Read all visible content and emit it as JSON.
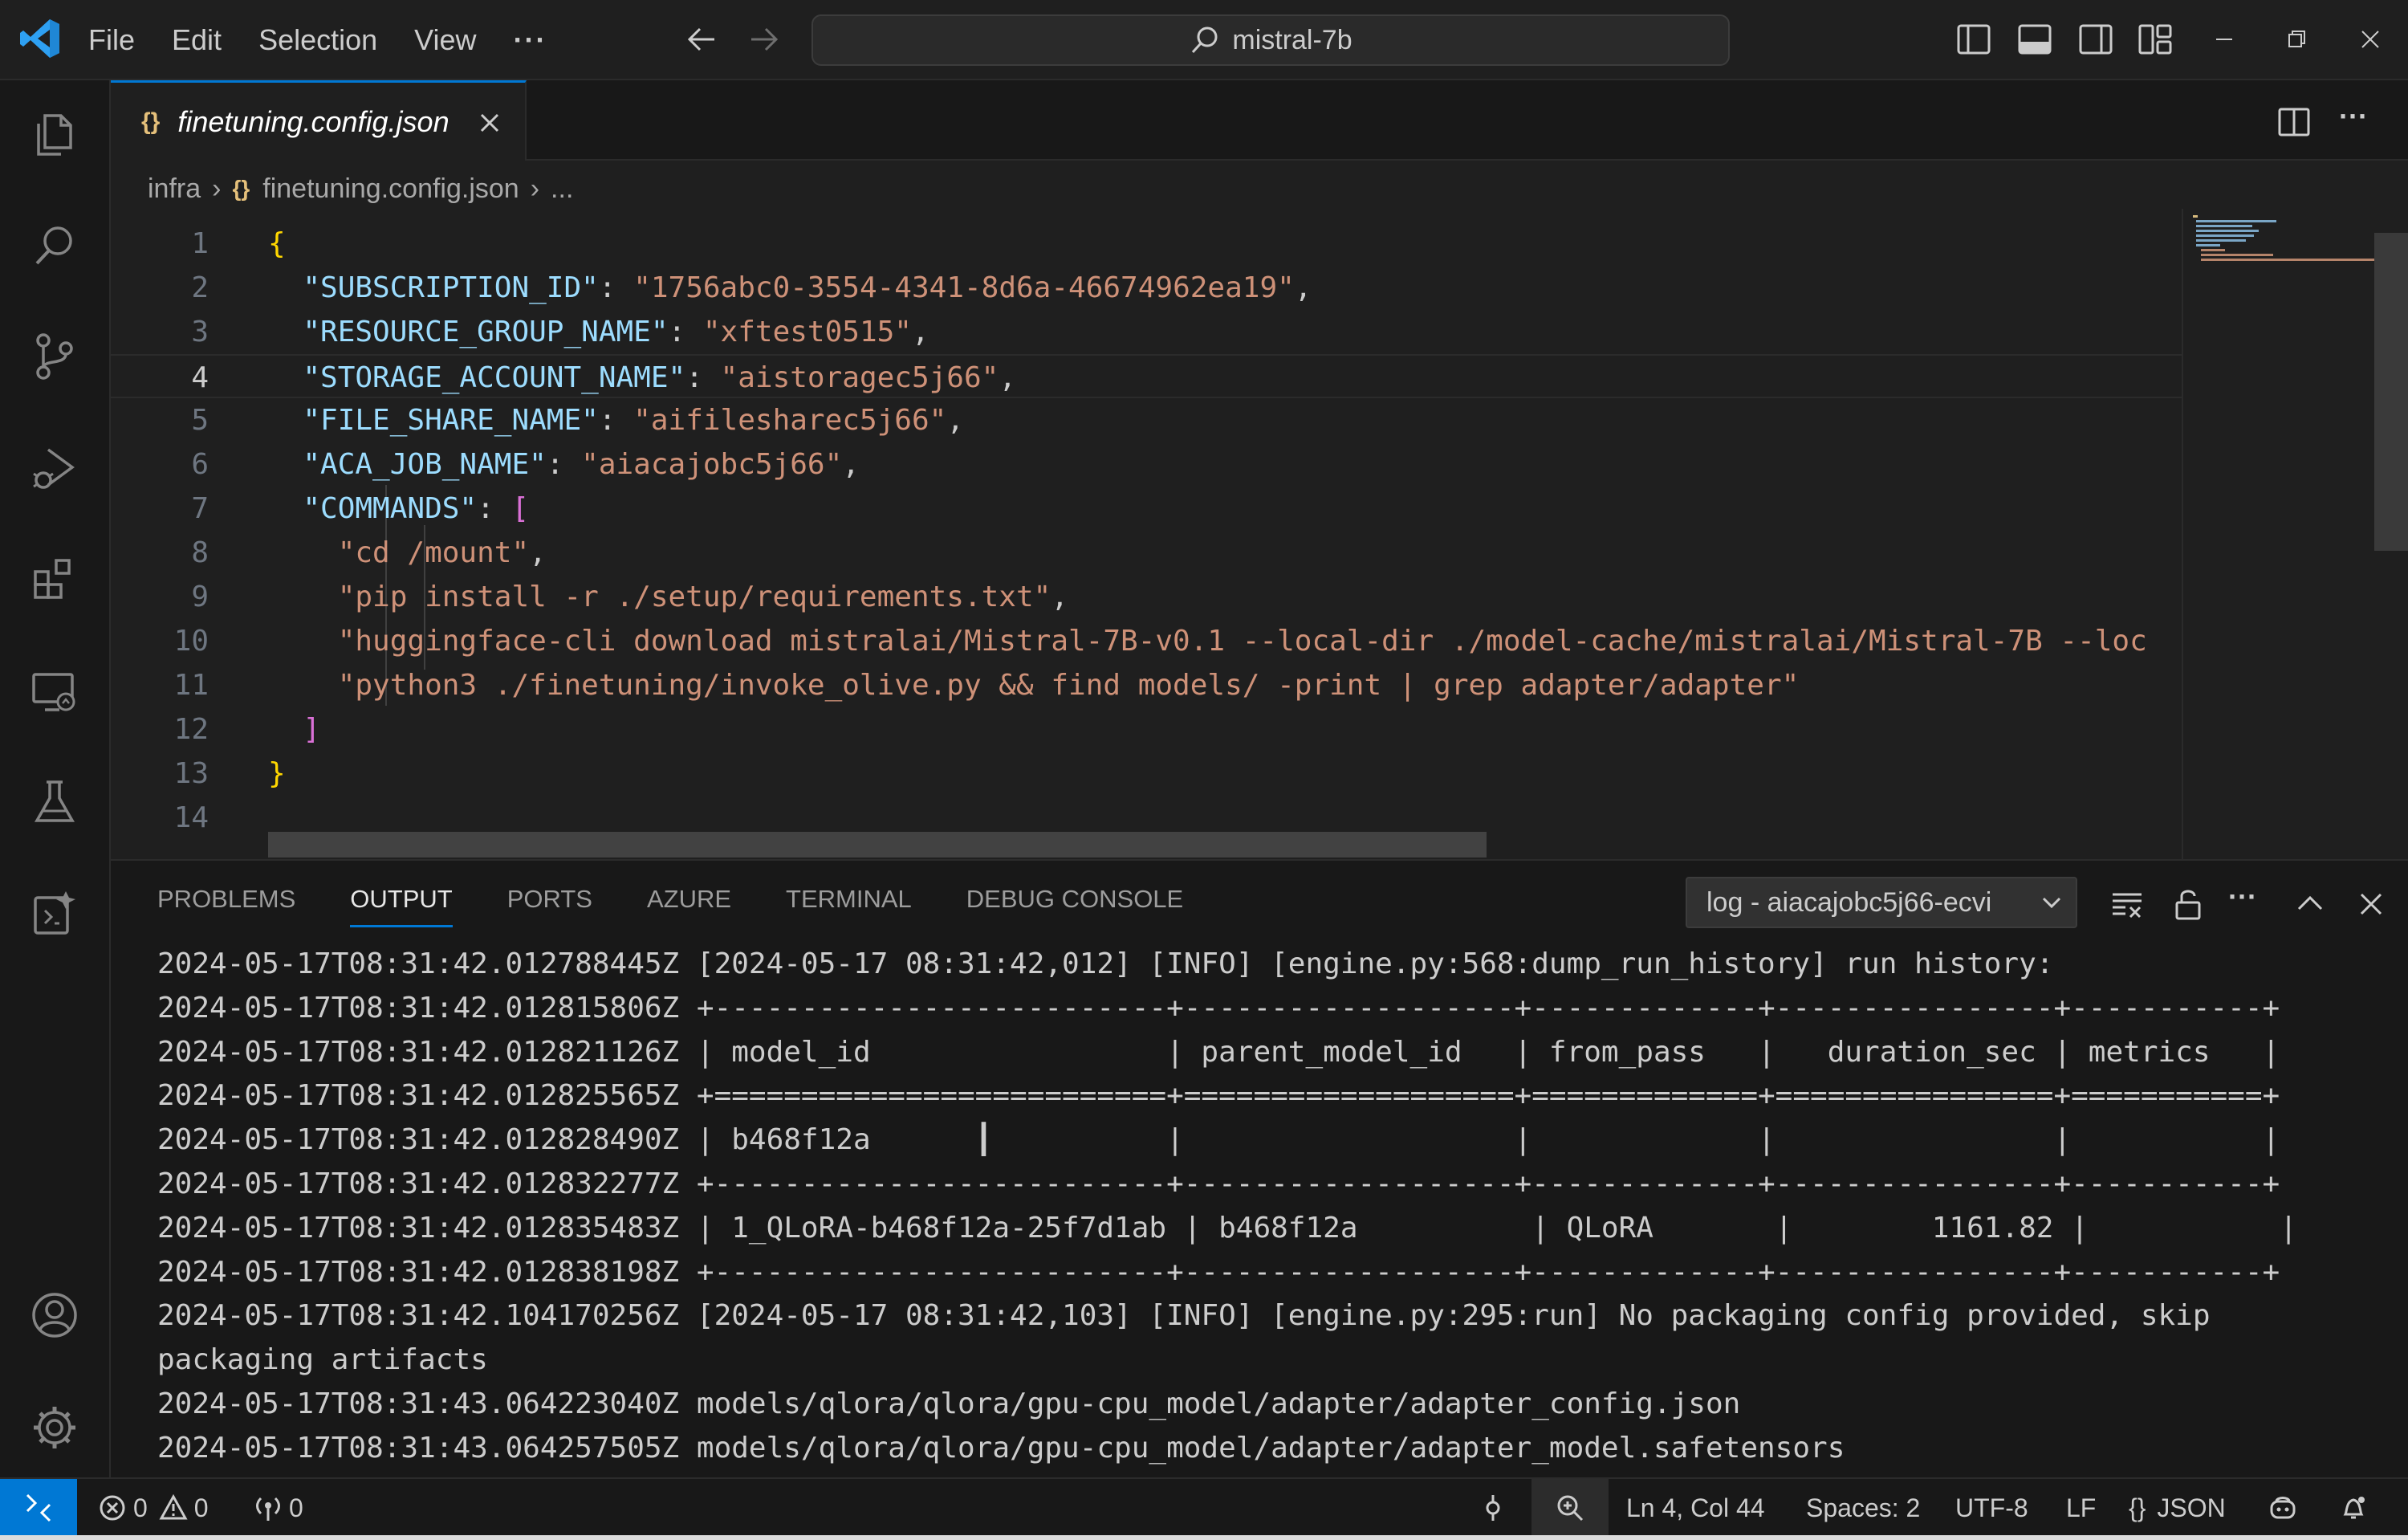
{
  "menu": [
    "File",
    "Edit",
    "Selection",
    "View"
  ],
  "search": {
    "text": "mistral-7b"
  },
  "tab": {
    "icon_text": "{}",
    "label": "finetuning.config.json"
  },
  "breadcrumb": {
    "folder": "infra",
    "icon_text": "{}",
    "file": "finetuning.config.json",
    "more": "..."
  },
  "editor": {
    "line_numbers": [
      "1",
      "2",
      "3",
      "4",
      "5",
      "6",
      "7",
      "8",
      "9",
      "10",
      "11",
      "12",
      "13",
      "14"
    ],
    "active_line": 4,
    "lines": [
      [
        {
          "t": "{",
          "c": "br1"
        }
      ],
      [
        {
          "t": "  "
        },
        {
          "t": "\"SUBSCRIPTION_ID\"",
          "c": "k"
        },
        {
          "t": ": "
        },
        {
          "t": "\"1756abc0-3554-4341-8d6a-46674962ea19\"",
          "c": "s"
        },
        {
          "t": ","
        }
      ],
      [
        {
          "t": "  "
        },
        {
          "t": "\"RESOURCE_GROUP_NAME\"",
          "c": "k"
        },
        {
          "t": ": "
        },
        {
          "t": "\"xftest0515\"",
          "c": "s"
        },
        {
          "t": ","
        }
      ],
      [
        {
          "t": "  "
        },
        {
          "t": "\"STORAGE_ACCOUNT_NAME\"",
          "c": "k"
        },
        {
          "t": ": "
        },
        {
          "t": "\"aistoragec5j66\"",
          "c": "s"
        },
        {
          "t": ","
        }
      ],
      [
        {
          "t": "  "
        },
        {
          "t": "\"FILE_SHARE_NAME\"",
          "c": "k"
        },
        {
          "t": ": "
        },
        {
          "t": "\"aifilesharec5j66\"",
          "c": "s"
        },
        {
          "t": ","
        }
      ],
      [
        {
          "t": "  "
        },
        {
          "t": "\"ACA_JOB_NAME\"",
          "c": "k"
        },
        {
          "t": ": "
        },
        {
          "t": "\"aiacajobc5j66\"",
          "c": "s"
        },
        {
          "t": ","
        }
      ],
      [
        {
          "t": "  "
        },
        {
          "t": "\"COMMANDS\"",
          "c": "k"
        },
        {
          "t": ": "
        },
        {
          "t": "[",
          "c": "br2"
        }
      ],
      [
        {
          "t": "    "
        },
        {
          "t": "\"cd /mount\"",
          "c": "s"
        },
        {
          "t": ","
        }
      ],
      [
        {
          "t": "    "
        },
        {
          "t": "\"pip install -r ./setup/requirements.txt\"",
          "c": "s"
        },
        {
          "t": ","
        }
      ],
      [
        {
          "t": "    "
        },
        {
          "t": "\"huggingface-cli download mistralai/Mistral-7B-v0.1 --local-dir ./model-cache/mistralai/Mistral-7B --loc",
          "c": "s"
        }
      ],
      [
        {
          "t": "    "
        },
        {
          "t": "\"python3 ./finetuning/invoke_olive.py && find models/ -print | grep adapter/adapter\"",
          "c": "s"
        }
      ],
      [
        {
          "t": "  "
        },
        {
          "t": "]",
          "c": "br2"
        }
      ],
      [
        {
          "t": "}",
          "c": "br1"
        }
      ],
      [
        {
          "t": ""
        }
      ]
    ]
  },
  "panel": {
    "tabs": [
      "PROBLEMS",
      "OUTPUT",
      "PORTS",
      "AZURE",
      "TERMINAL",
      "DEBUG CONSOLE"
    ],
    "active_tab": "OUTPUT",
    "log_select": "log - aiacajobc5j66-ecvi",
    "output_lines": [
      "2024-05-17T08:31:42.012788445Z [2024-05-17 08:31:42,012] [INFO] [engine.py:568:dump_run_history] run history:",
      "2024-05-17T08:31:42.012815806Z +--------------------------+-------------------+-------------+----------------+-----------+",
      "2024-05-17T08:31:42.012821126Z | model_id                 | parent_model_id   | from_pass   |   duration_sec | metrics   |",
      "2024-05-17T08:31:42.012825565Z +==========================+===================+=============+================+===========+",
      "2024-05-17T08:31:42.012828490Z | b468f12a      ┃          |                   |             |                |           |",
      "2024-05-17T08:31:42.012832277Z +--------------------------+-------------------+-------------+----------------+-----------+",
      "2024-05-17T08:31:42.012835483Z | 1_QLoRA-b468f12a-25f7d1ab | b468f12a          | QLoRA       |        1161.82 |           |",
      "2024-05-17T08:31:42.012838198Z +--------------------------+-------------------+-------------+----------------+-----------+",
      "2024-05-17T08:31:42.104170256Z [2024-05-17 08:31:42,103] [INFO] [engine.py:295:run] No packaging config provided, skip",
      "packaging artifacts",
      "2024-05-17T08:31:43.064223040Z models/qlora/qlora/gpu-cpu_model/adapter/adapter_config.json",
      "2024-05-17T08:31:43.064257505Z models/qlora/qlora/gpu-cpu_model/adapter/adapter_model.safetensors"
    ]
  },
  "status": {
    "errors": "0",
    "warnings": "0",
    "ports": "0",
    "position": "Ln 4, Col 44",
    "spaces": "Spaces: 2",
    "encoding": "UTF-8",
    "eol": "LF",
    "lang_icon": "{}",
    "language": "JSON"
  },
  "colors": {
    "accent": "#0078d4",
    "key": "#9cdcfe",
    "string": "#ce9178",
    "bracket1": "#ffd700",
    "bracket2": "#da70d6"
  }
}
